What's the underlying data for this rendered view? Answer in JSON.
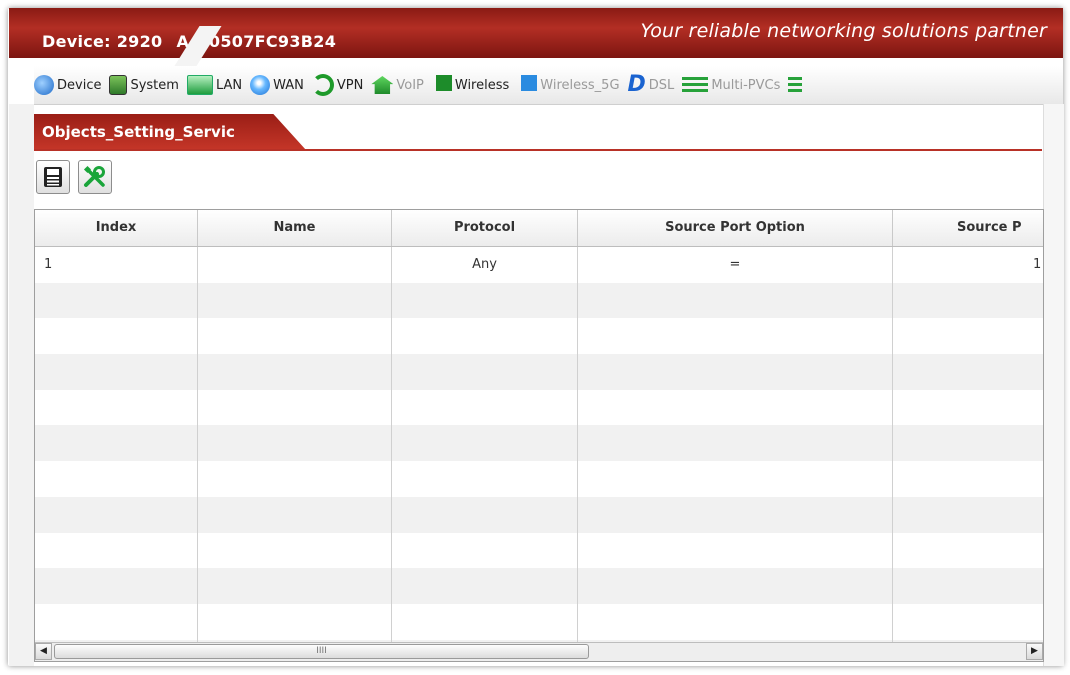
{
  "header": {
    "device_label": "Device: 2920",
    "device_suffix": "A_00507FC93B24",
    "slogan": "Your reliable networking solutions partner"
  },
  "nav": {
    "items": [
      {
        "label": "Device",
        "icon": "globe-icon",
        "enabled": true
      },
      {
        "label": "System",
        "icon": "system-icon",
        "enabled": true
      },
      {
        "label": "LAN",
        "icon": "monitor-icon",
        "enabled": true
      },
      {
        "label": "WAN",
        "icon": "globe-icon",
        "enabled": true
      },
      {
        "label": "VPN",
        "icon": "vpn-icon",
        "enabled": true
      },
      {
        "label": "VoIP",
        "icon": "phone-house-icon",
        "enabled": false
      },
      {
        "label": "Wireless",
        "icon": "wireless-icon",
        "enabled": true
      },
      {
        "label": "Wireless_5G",
        "icon": "wireless-icon",
        "enabled": false
      },
      {
        "label": "DSL",
        "icon": "dsl-icon",
        "enabled": false
      },
      {
        "label": "Multi-PVCs",
        "icon": "lines-icon",
        "enabled": false
      }
    ]
  },
  "tab": {
    "title": "Objects_Setting_Servic"
  },
  "toolbar": {
    "save_icon": "save-icon",
    "tools_icon": "tools-icon"
  },
  "grid": {
    "columns": [
      "Index",
      "Name",
      "Protocol",
      "Source Port Option",
      "Source P"
    ],
    "rows": [
      {
        "index": "1",
        "name": "",
        "protocol": "Any",
        "source_port_option": "=",
        "source_port": "1"
      }
    ],
    "empty_rows": 11,
    "scroll_thumb_glyph": "IIII"
  },
  "colors": {
    "brand_red": "#b32e24",
    "nav_green": "#27a23a"
  }
}
